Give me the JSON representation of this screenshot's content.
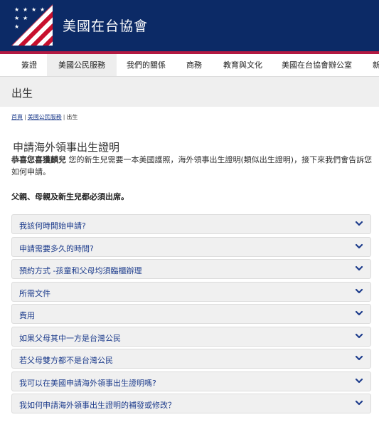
{
  "header": {
    "title": "美國在台協會",
    "logo_icon": "flag-logo-icon"
  },
  "nav": {
    "items": [
      {
        "label": "簽證",
        "active": false
      },
      {
        "label": "美國公民服務",
        "active": true
      },
      {
        "label": "我們的關係",
        "active": false
      },
      {
        "label": "商務",
        "active": false
      },
      {
        "label": "教育與文化",
        "active": false
      },
      {
        "label": "美國在台協會辦公室",
        "active": false
      },
      {
        "label": "新",
        "active": false
      }
    ]
  },
  "banner": {
    "title": "出生"
  },
  "breadcrumb": {
    "items": [
      "首頁",
      "美國公民服務",
      "出生"
    ],
    "separator": "|"
  },
  "content": {
    "heading": "申請海外領事出生證明",
    "intro_bold": "恭喜您喜獲麟兒",
    "intro_text": " 您的新生兒需要一本美國護照，海外領事出生證明(類似出生證明)，接下來我們會告訴您如何申請。",
    "notice": "父親、母親及新生兒都必須出席。"
  },
  "accordion": {
    "items": [
      "我該何時開始申請?",
      "申請需要多久的時間?",
      "預約方式 -孩童和父母均須臨櫃辦理",
      "所需文件",
      "費用",
      "如果父母其中一方是台灣公民",
      "若父母雙方都不是台灣公民",
      "我可以在美國申請海外領事出生證明嗎?",
      "我如何申請海外領事出生證明的補發或修改？"
    ],
    "icon": "chevron-down-icon"
  },
  "colors": {
    "header_bg": "#0c2a66",
    "accent_red": "#b31942",
    "link_blue": "#1d3c8c",
    "banner_bg": "#efefef"
  }
}
